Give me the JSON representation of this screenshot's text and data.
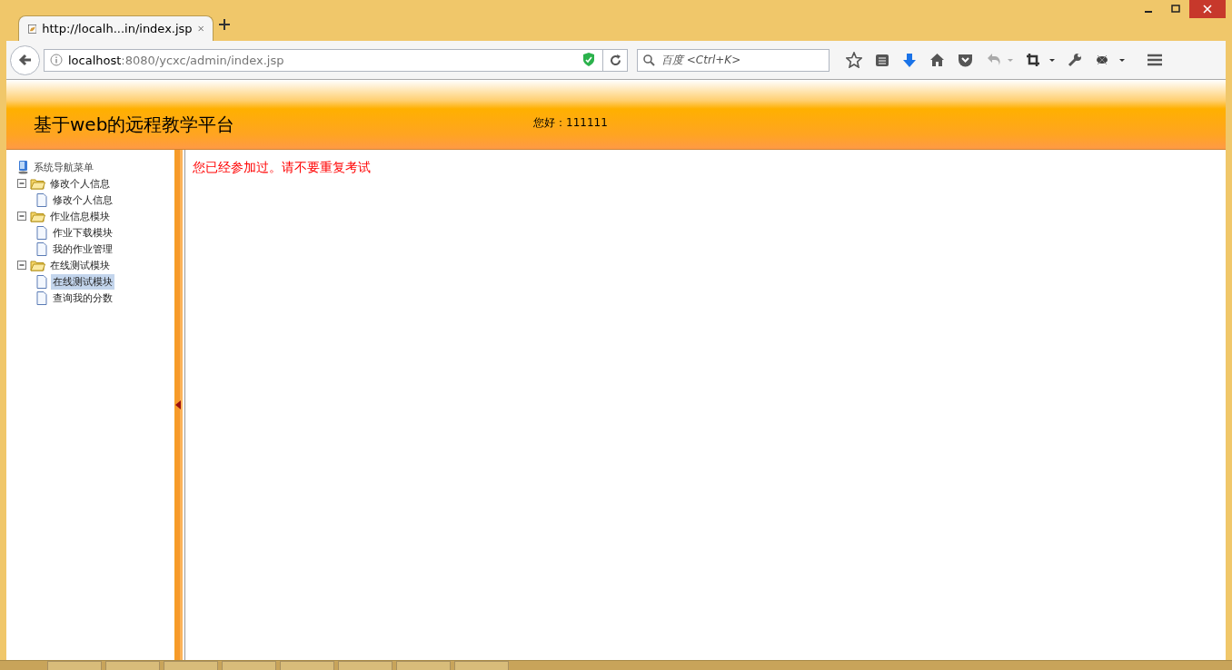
{
  "browser": {
    "tab_title": "http://localh...in/index.jsp",
    "url_host": "localhost",
    "url_path": ":8080/ycxc/admin/index.jsp",
    "search_placeholder": "百度 <Ctrl+K>"
  },
  "header": {
    "title": "基于web的远程教学平台",
    "greeting": "您好：111111"
  },
  "nav": {
    "root": "系统导航菜单",
    "items": [
      {
        "label": "修改个人信息",
        "expanded": true,
        "children": [
          {
            "label": "修改个人信息",
            "selected": false
          }
        ]
      },
      {
        "label": "作业信息模块",
        "expanded": true,
        "children": [
          {
            "label": "作业下载模块",
            "selected": false
          },
          {
            "label": "我的作业管理",
            "selected": false
          }
        ]
      },
      {
        "label": "在线测试模块",
        "expanded": true,
        "children": [
          {
            "label": "在线测试模块",
            "selected": true
          },
          {
            "label": "查询我的分数",
            "selected": false
          }
        ]
      }
    ]
  },
  "message": "您已经参加过。请不要重复考试"
}
